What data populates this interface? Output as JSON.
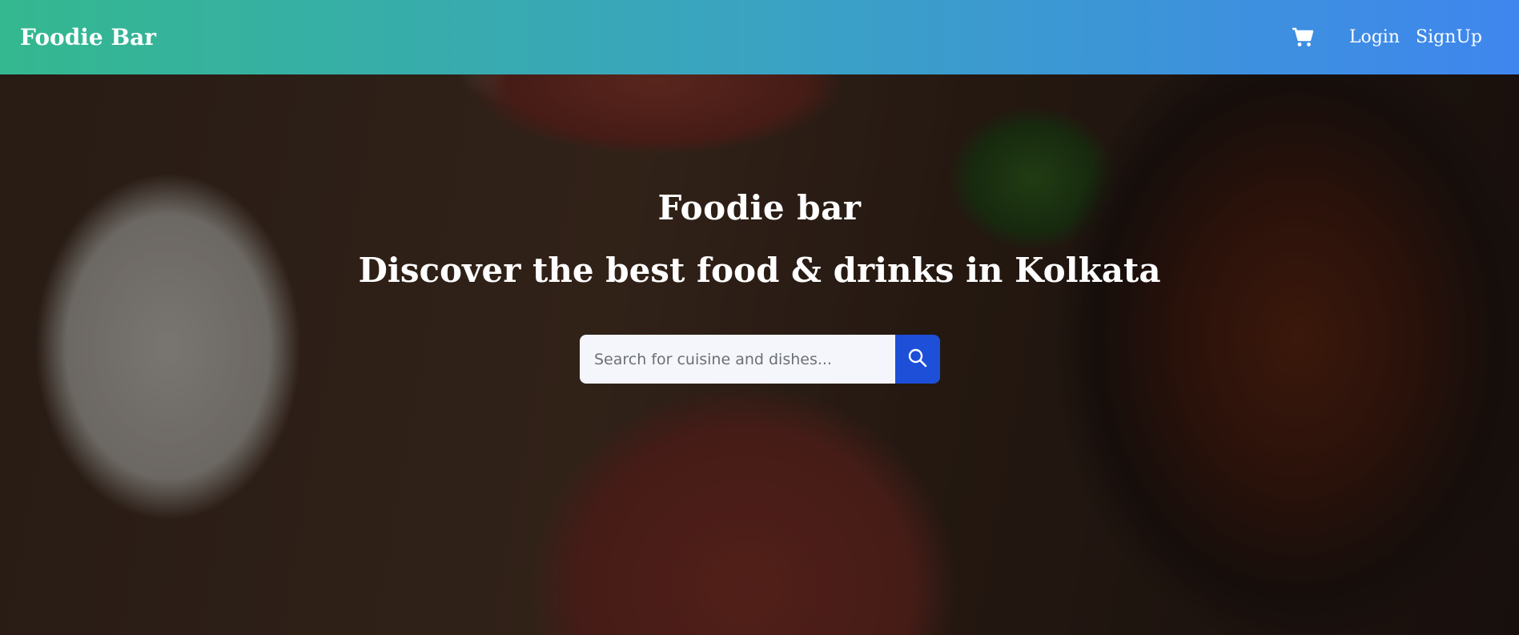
{
  "navbar": {
    "brand": "Foodie Bar",
    "cart_icon": "cart-icon",
    "login_label": "Login",
    "signup_label": "SignUp"
  },
  "hero": {
    "title": "Foodie bar",
    "subtitle": "Discover the best food & drinks in Kolkata",
    "search": {
      "placeholder": "Search for cuisine and dishes...",
      "value": "",
      "button_icon": "search-icon"
    }
  },
  "colors": {
    "navbar_gradient_start": "#34b88f",
    "navbar_gradient_end": "#3f86ee",
    "search_button": "#1d4fd8",
    "text": "#ffffff"
  }
}
